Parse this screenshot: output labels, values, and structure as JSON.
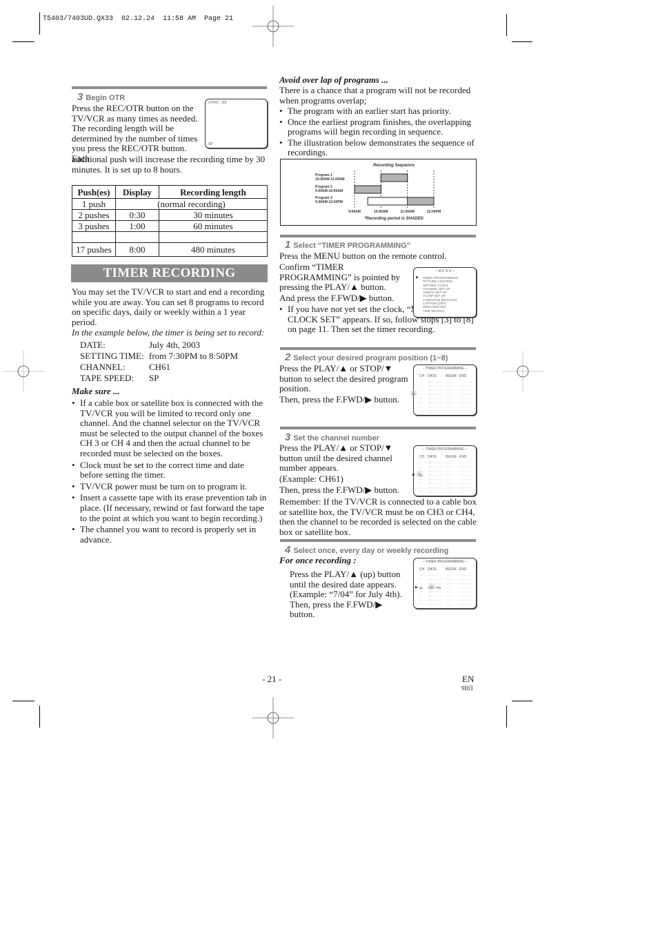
{
  "print_header": "T5403/7403UD.QX33  02.12.24  11:58 AM  Page 21",
  "otr": {
    "step_num": "3",
    "title": "Begin OTR",
    "para1": "Press the REC/OTR button on the TV/VCR as many times as needed. The recording length will be determined by the number of times you press the REC/OTR button. Each",
    "para2": "additional push will increase the recording time by 30 minutes. It is set up to 8 hours.",
    "screen": {
      "top_label": "OTR(2 : 30)",
      "bottom_label": "SP"
    },
    "table": {
      "headers": [
        "Push(es)",
        "Display",
        "Recording length"
      ],
      "rows": [
        [
          "1 push",
          "(normal recording)",
          ""
        ],
        [
          "2 pushes",
          "0:30",
          "30 minutes"
        ],
        [
          "3 pushes",
          "1:00",
          "60 minutes"
        ],
        [
          "",
          "",
          ""
        ],
        [
          "17 pushes",
          "8:00",
          "480 minutes"
        ]
      ]
    }
  },
  "timer": {
    "banner": "TIMER RECORDING",
    "intro": "You may set the TV/VCR to start and end a recording while you are away. You can set 8 programs to record on specific days, daily or weekly within a 1 year period.",
    "example_lead": "In the example below, the timer is being set to record:",
    "example": [
      {
        "k": "DATE:",
        "v": "July 4th, 2003"
      },
      {
        "k": "SETTING TIME:",
        "v": "from 7:30PM to 8:50PM"
      },
      {
        "k": "CHANNEL:",
        "v": "CH61"
      },
      {
        "k": "TAPE SPEED:",
        "v": "SP"
      }
    ],
    "make_sure_title": "Make sure ...",
    "make_sure": [
      "If a cable box or satellite box is connected with the TV/VCR you will be limited to record only one channel.  And the channel selector on the TV/VCR must be selected to the output channel of the boxes CH 3 or CH 4 and then the actual channel to be recorded must be selected on the boxes.",
      "Clock must be set to the correct time and date before setting the timer.",
      "TV/VCR power must be turn on to program it.",
      "Insert a cassette tape with its erase prevention tab in place. (If necessary, rewind or fast forward the tape to the point at which you want to begin recording.)",
      "The channel you want to record is properly set in advance."
    ]
  },
  "overlap": {
    "title": "Avoid over lap of programs ...",
    "intro": "There is a chance that a program will not be recorded when programs overlap;",
    "bullets": [
      "The program with an earlier start has priority.",
      "Once the earliest program finishes, the overlapping programs will begin recording in sequence.",
      "The illustration below demonstrates the sequence of recordings."
    ]
  },
  "chart_data": {
    "type": "gantt",
    "title": "Recording Sequence",
    "note": "*Recording period is SHADED",
    "x_ticks": [
      "9:00AM",
      "10:00AM",
      "11:00AM",
      "12:00PM"
    ],
    "x_range_hours": [
      9,
      12
    ],
    "programs": [
      {
        "name": "Program 1",
        "time_label": "10:00AM-11:00AM",
        "start": 10.0,
        "end": 11.0,
        "recorded": [
          [
            10.0,
            11.0
          ]
        ]
      },
      {
        "name": "Program 2",
        "time_label": "9:00AM-10:00AM",
        "start": 9.0,
        "end": 10.0,
        "recorded": [
          [
            9.0,
            10.0
          ]
        ]
      },
      {
        "name": "Program 3",
        "time_label": "9:30AM-12:00PM",
        "start": 9.5,
        "end": 12.0,
        "recorded": [
          [
            11.0,
            12.0
          ]
        ]
      }
    ],
    "colors": {
      "shaded": "#b3b3b3",
      "unshaded": "#ffffff"
    }
  },
  "step1": {
    "num": "1",
    "title": "Select “TIMER PROGRAMMING”",
    "line1": "Press the MENU button on the remote control.",
    "line2": "Confirm “TIMER PROGRAMMING” is pointed by pressing the PLAY/▲ button.",
    "line3": "And press the F.FWD/▶ button.",
    "bullet": "If you have not yet set the clock, “MANUAL CLOCK SET” appears. If so, follow stops [3] to [8] on page 11. Then set the timer recording.",
    "menu": {
      "title": "– M E N U –",
      "items": [
        "TIMER PROGRAMMING",
        "PICTURE CONTROL",
        "SETTING CLOCK",
        "CHANNEL SET UP",
        "USER'S SET UP",
        "V-CHIP SET UP",
        "LANGUAGE  [ENGLISH]",
        "CAPTION  [OFF]",
        "ZERO RETURN",
        "TIME SEARCH"
      ],
      "selected_index": 0
    }
  },
  "step2": {
    "num": "2",
    "title": "Select your desired program position (1~8)",
    "text": "Press the PLAY/▲ or STOP/▼ button to select the desired program position.",
    "text2": "Then, press the F.FWD/▶ button."
  },
  "step3": {
    "num": "3",
    "title": "Set the channel number",
    "text": "Press the PLAY/▲ or STOP/▼ button until the desired channel number appears.",
    "example": "(Example: CH61)",
    "text2": "Then, press the F.FWD/▶ button.",
    "remember": "Remember: If the TV/VCR is connected to a cable box or satellite box, the TV/VCR must be on CH3 or CH4, then the channel to be recorded is selected on the cable box or satellite box."
  },
  "step4": {
    "num": "4",
    "title": "Select once, every day or weekly recording",
    "subtitle": "For once recording :",
    "text": "Press the PLAY/▲ (up) button until the desired date appears. (Example: “7/04” for July 4th). Then, press the F.FWD/▶ button."
  },
  "timer_screen": {
    "title": "– TIMER PROGRAMMING –",
    "headers": [
      "CH",
      "DATE",
      "BEGIN",
      "END"
    ],
    "empty_row": [
      "- -",
      "- / - -",
      "- - -",
      "- : - -",
      "- : - -",
      "- -"
    ],
    "row_count": 8,
    "step3_channel": "61",
    "step4_row": [
      "61",
      "7/04",
      "FRI",
      "- -"
    ]
  },
  "footer": {
    "page": "- 21 -",
    "lang": "EN",
    "code": "9I03"
  }
}
